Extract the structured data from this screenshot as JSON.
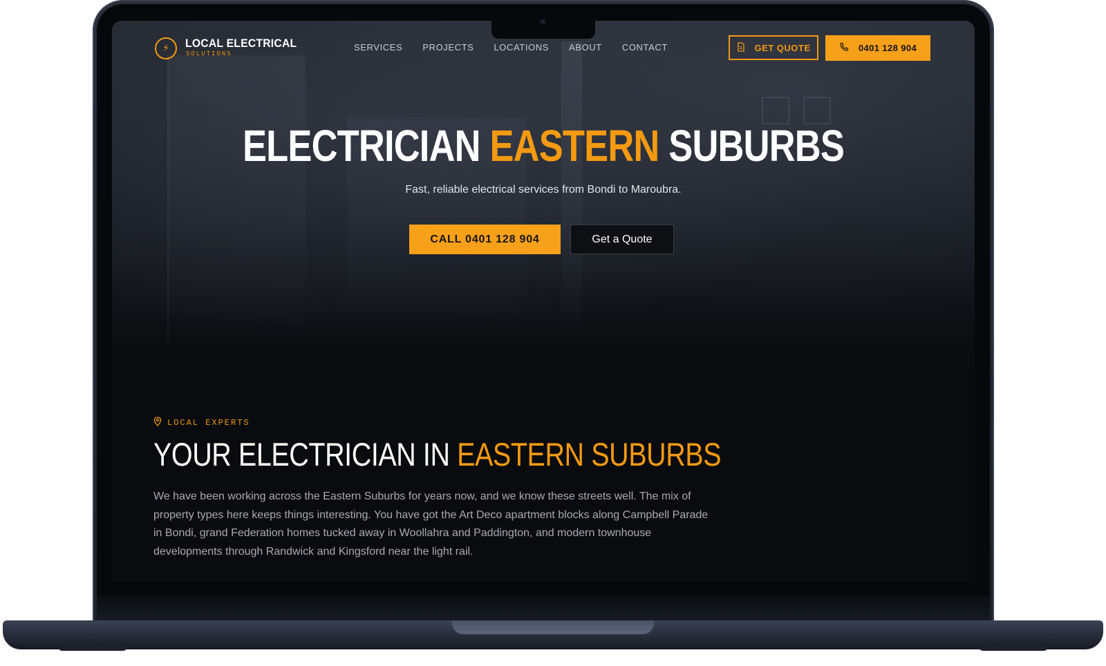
{
  "brand": {
    "name": "LOCAL ELECTRICAL",
    "tagline": "SOLUTIONS",
    "accent_color": "#f39a12",
    "logo_icon": "bolt-icon"
  },
  "nav": {
    "links": [
      "SERVICES",
      "PROJECTS",
      "LOCATIONS",
      "ABOUT",
      "CONTACT"
    ],
    "quote_button": "GET QUOTE",
    "quote_icon": "document-icon",
    "phone_button": "0401 128 904",
    "phone_icon": "phone-icon"
  },
  "hero": {
    "title_part1": "ELECTRICIAN",
    "title_accent": "EASTERN",
    "title_part2": "SUBURBS",
    "subtitle": "Fast, reliable electrical services from Bondi to Maroubra.",
    "call_button": "CALL 0401 128 904",
    "quote_button": "Get a Quote"
  },
  "section": {
    "eyebrow": "LOCAL EXPERTS",
    "eyebrow_icon": "location-pin-icon",
    "title_plain": "YOUR ELECTRICIAN IN",
    "title_accent": "EASTERN SUBURBS",
    "body": "We have been working across the Eastern Suburbs for years now, and we know these streets well. The mix of property types here keeps things interesting. You have got the Art Deco apartment blocks along Campbell Parade in Bondi, grand Federation homes tucked away in Woollahra and Paddington, and modern townhouse developments through Randwick and Kingsford near the light rail."
  }
}
